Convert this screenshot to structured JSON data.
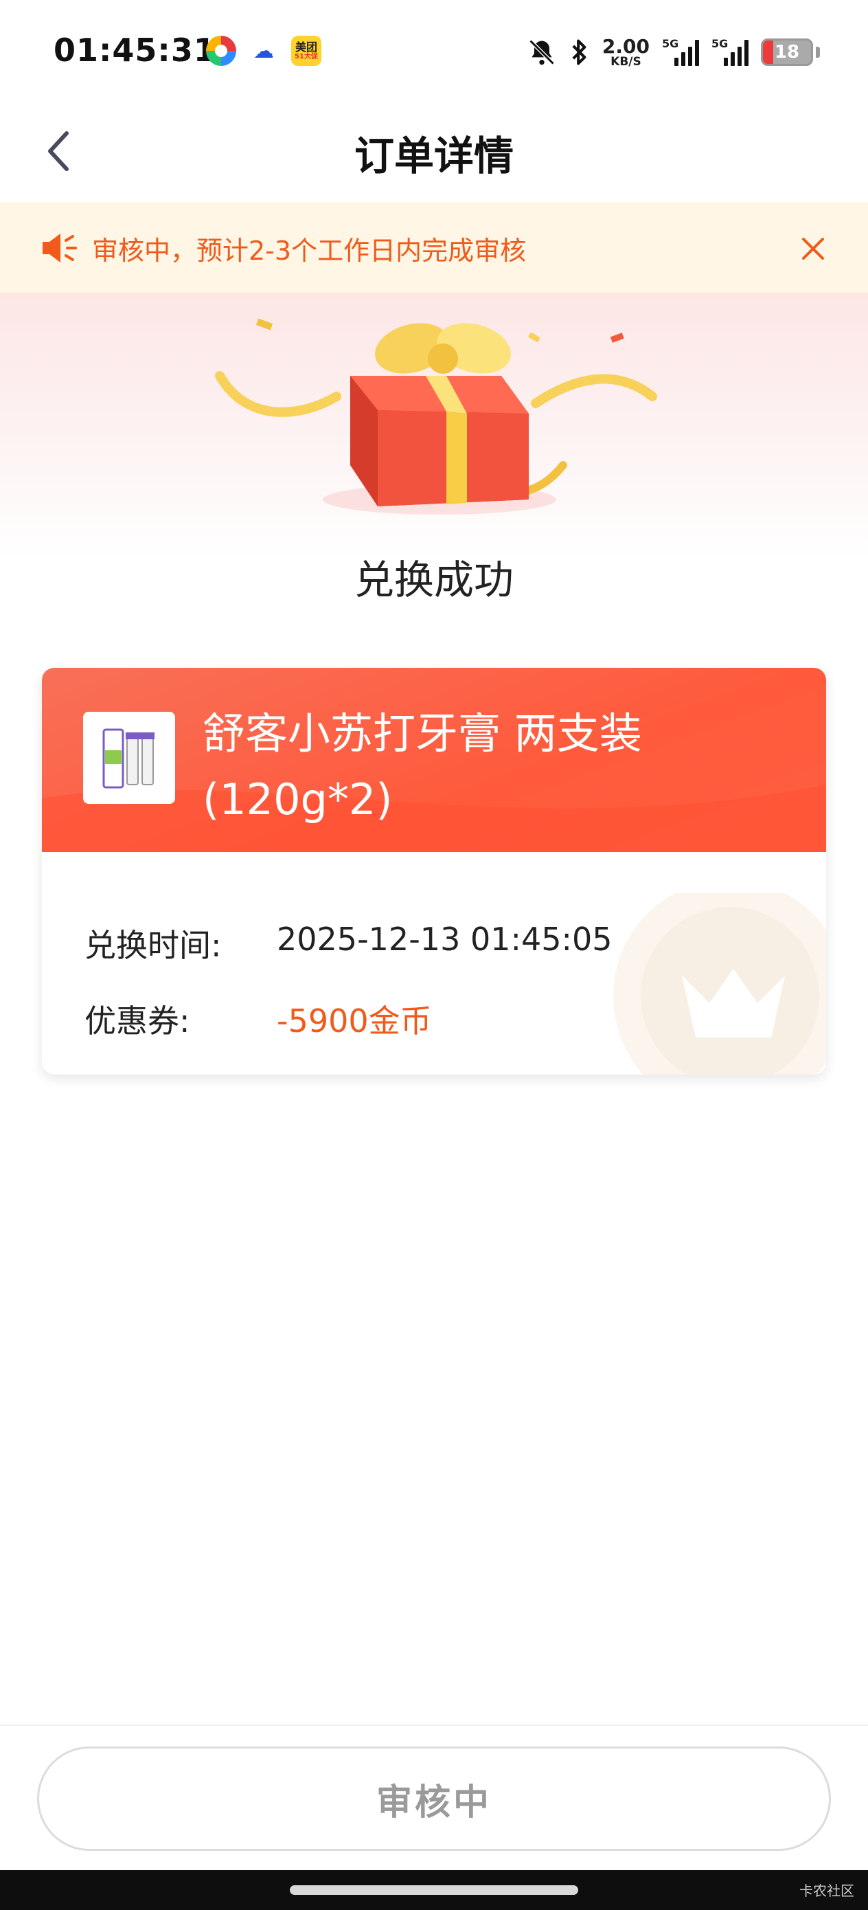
{
  "status_bar": {
    "time": "01:45:31",
    "net_speed_value": "2.00",
    "net_speed_unit": "KB/S",
    "signal1_tag": "5G",
    "signal2_tag": "5G",
    "battery": "18",
    "app_icons": [
      "colorful-ring-app-icon",
      "cloud-app-icon",
      "meituan-app-icon"
    ],
    "meituan_label": "美团",
    "meituan_sub": "51大促"
  },
  "header": {
    "title": "订单详情"
  },
  "notice": {
    "text": "审核中，预计2-3个工作日内完成审核"
  },
  "hero": {
    "success_text": "兑换成功"
  },
  "order_card": {
    "product_name": "舒客小苏打牙膏  两支装(120g*2)",
    "rows": [
      {
        "label": "兑换时间:",
        "value": "2025-12-13 01:45:05"
      },
      {
        "label": "优惠券:",
        "value": "-5900金币"
      }
    ]
  },
  "footer": {
    "button_label": "审核中",
    "watermark": "卡农社区"
  },
  "colors": {
    "accent": "#f05a1a",
    "card_header": "#ff5a3c",
    "notice_bg": "#fff6e6"
  }
}
